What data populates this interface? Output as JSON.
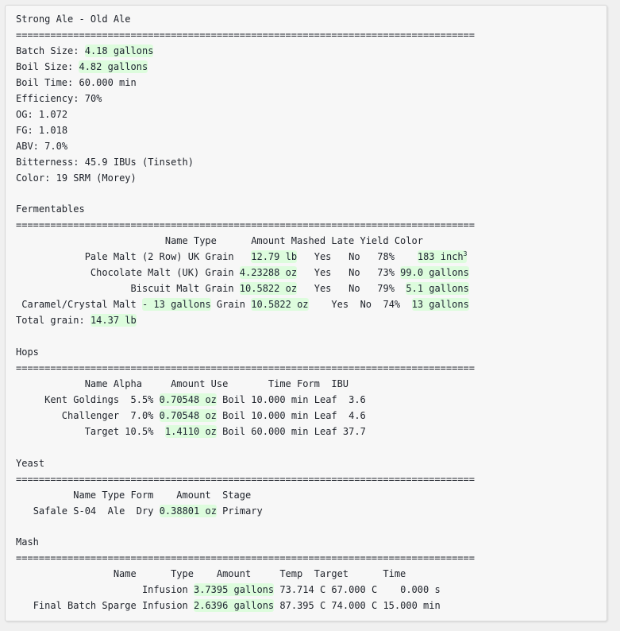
{
  "recipe": {
    "title": "Strong Ale - Old Ale",
    "separator": "================================================================================",
    "summary": [
      {
        "label": "Batch Size:",
        "value": "4.18 gallons",
        "highlight": true
      },
      {
        "label": "Boil Size:",
        "value": "4.82 gallons",
        "highlight": true
      },
      {
        "label": "Boil Time:",
        "value": "60.000 min",
        "highlight": false
      },
      {
        "label": "Efficiency:",
        "value": "70%",
        "highlight": false
      },
      {
        "label": "OG:",
        "value": "1.072",
        "highlight": false
      },
      {
        "label": "FG:",
        "value": "1.018",
        "highlight": false
      },
      {
        "label": "ABV:",
        "value": "7.0%",
        "highlight": false
      },
      {
        "label": "Bitterness:",
        "value": "45.9 IBUs (Tinseth)",
        "highlight": false
      },
      {
        "label": "Color:",
        "value": "19 SRM (Morey)",
        "highlight": false
      }
    ]
  },
  "fermentables": {
    "section_title": "Fermentables",
    "separator": "================================================================================",
    "columns": [
      "Name",
      "Type",
      "Amount",
      "Mashed",
      "Late",
      "Yield",
      "Color"
    ],
    "rows": [
      {
        "name": "Pale Malt (2 Row) UK",
        "type": "Grain",
        "amount": "12.79 lb",
        "mashed": "Yes",
        "late": "No",
        "yield": "78%",
        "color": "183 inch³"
      },
      {
        "name": "Chocolate Malt (UK)",
        "type": "Grain",
        "amount": "4.23288 oz",
        "mashed": "Yes",
        "late": "No",
        "yield": "73%",
        "color": "99.0 gallons"
      },
      {
        "name": "Biscuit Malt",
        "type": "Grain",
        "amount": "10.5822 oz",
        "mashed": "Yes",
        "late": "No",
        "yield": "79%",
        "color": "5.1 gallons"
      },
      {
        "name": "Caramel/Crystal Malt",
        "name_suffix": "- 13 gallons",
        "type": "Grain",
        "amount": "10.5822 oz",
        "mashed": "Yes",
        "late": "No",
        "yield": "74%",
        "color": "13 gallons"
      }
    ],
    "total_label": "Total grain:",
    "total_value": "14.37 lb"
  },
  "hops": {
    "section_title": "Hops",
    "separator": "================================================================================",
    "columns": [
      "Name",
      "Alpha",
      "Amount",
      "Use",
      "Time",
      "Form",
      "IBU"
    ],
    "rows": [
      {
        "name": "Kent Goldings",
        "alpha": "5.5%",
        "amount": "0.70548 oz",
        "use": "Boil",
        "time": "10.000 min",
        "form": "Leaf",
        "ibu": "3.6"
      },
      {
        "name": "Challenger",
        "alpha": "7.0%",
        "amount": "0.70548 oz",
        "use": "Boil",
        "time": "10.000 min",
        "form": "Leaf",
        "ibu": "4.6"
      },
      {
        "name": "Target",
        "alpha": "10.5%",
        "amount": "1.4110 oz",
        "use": "Boil",
        "time": "60.000 min",
        "form": "Leaf",
        "ibu": "37.7"
      }
    ]
  },
  "yeast": {
    "section_title": "Yeast",
    "separator": "================================================================================",
    "columns": [
      "Name",
      "Type",
      "Form",
      "Amount",
      "Stage"
    ],
    "rows": [
      {
        "name": "Safale S-04",
        "type": "Ale",
        "form": "Dry",
        "amount": "0.38801 oz",
        "stage": "Primary"
      }
    ]
  },
  "mash": {
    "section_title": "Mash",
    "separator": "================================================================================",
    "columns": [
      "Name",
      "Type",
      "Amount",
      "Temp",
      "Target",
      "Time"
    ],
    "rows": [
      {
        "name": "",
        "type": "Infusion",
        "amount": "3.7395 gallons",
        "temp": "73.714 C",
        "target": "67.000 C",
        "time": "0.000 s"
      },
      {
        "name": "Final Batch Sparge",
        "type": "Infusion",
        "amount": "2.6396 gallons",
        "temp": "87.395 C",
        "target": "74.000 C",
        "time": "15.000 min"
      }
    ]
  },
  "theme": {
    "highlight_bg": "#ddfcdd",
    "text_color": "#20242c",
    "card_bg": "#f7f7f7",
    "page_bg": "#f0f0f0",
    "border_color": "#d7d7d7"
  }
}
